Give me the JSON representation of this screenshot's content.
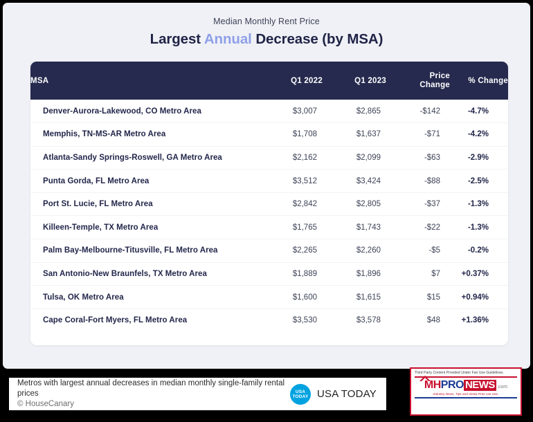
{
  "graphic": {
    "kicker": "Median Monthly Rent Price",
    "headline_pre": "Largest ",
    "headline_highlight": "Annual",
    "headline_post": " Decrease (by MSA)",
    "highlight_color": "#8fa0e8",
    "header_bg": "#262a4e",
    "background": "#f0f1f6"
  },
  "table": {
    "columns": [
      {
        "key": "msa",
        "label": "MSA"
      },
      {
        "key": "q1_2022",
        "label": "Q1 2022"
      },
      {
        "key": "q1_2023",
        "label": "Q1 2023"
      },
      {
        "key": "price_change",
        "label": "Price\nChange",
        "label_line1": "Price",
        "label_line2": "Change"
      },
      {
        "key": "pct_change",
        "label": "% Change"
      }
    ],
    "rows": [
      {
        "msa": "Denver-Aurora-Lakewood, CO Metro Area",
        "q1_2022": "$3,007",
        "q1_2023": "$2,865",
        "price_change": "-$142",
        "pct_change": "-4.7%"
      },
      {
        "msa": "Memphis, TN-MS-AR Metro Area",
        "q1_2022": "$1,708",
        "q1_2023": "$1,637",
        "price_change": "-$71",
        "pct_change": "-4.2%"
      },
      {
        "msa": "Atlanta-Sandy Springs-Roswell, GA Metro Area",
        "q1_2022": "$2,162",
        "q1_2023": "$2,099",
        "price_change": "-$63",
        "pct_change": "-2.9%"
      },
      {
        "msa": "Punta Gorda, FL Metro Area",
        "q1_2022": "$3,512",
        "q1_2023": "$3,424",
        "price_change": "-$88",
        "pct_change": "-2.5%"
      },
      {
        "msa": "Port St. Lucie, FL Metro Area",
        "q1_2022": "$2,842",
        "q1_2023": "$2,805",
        "price_change": "-$37",
        "pct_change": "-1.3%"
      },
      {
        "msa": "Killeen-Temple, TX Metro Area",
        "q1_2022": "$1,765",
        "q1_2023": "$1,743",
        "price_change": "-$22",
        "pct_change": "-1.3%"
      },
      {
        "msa": "Palm Bay-Melbourne-Titusville, FL Metro Area",
        "q1_2022": "$2,265",
        "q1_2023": "$2,260",
        "price_change": "-$5",
        "pct_change": "-0.2%"
      },
      {
        "msa": "San Antonio-New Braunfels, TX Metro Area",
        "q1_2022": "$1,889",
        "q1_2023": "$1,896",
        "price_change": "$7",
        "pct_change": "+0.37%"
      },
      {
        "msa": "Tulsa, OK Metro Area",
        "q1_2022": "$1,600",
        "q1_2023": "$1,615",
        "price_change": "$15",
        "pct_change": "+0.94%"
      },
      {
        "msa": "Cape Coral-Fort Myers, FL Metro Area",
        "q1_2022": "$3,530",
        "q1_2023": "$3,578",
        "price_change": "$48",
        "pct_change": "+1.36%"
      }
    ]
  },
  "caption": {
    "line1": "Metros with largest annual decreases in median monthly single-family rental prices",
    "line2": "© HouseCanary"
  },
  "usatoday": {
    "circle_line1": "USA",
    "circle_line2": "TODAY",
    "wordmark": "USA TODAY",
    "brand_color": "#00a3e0"
  },
  "mhpronews": {
    "fair_use": "Third Party Content Provided Under Fair Use Guidelines.",
    "mh": "MH",
    "pro": "PRO",
    "news": "NEWS",
    "dotcom": ".com",
    "tagline": "Industry News, Tips and Views Pros can Use.",
    "red": "#c8102e",
    "blue": "#1b3a93"
  },
  "chart_data": {
    "type": "table",
    "title": "Largest Annual Decrease (by MSA)",
    "subtitle": "Median Monthly Rent Price",
    "source": "© HouseCanary",
    "columns": [
      "MSA",
      "Q1 2022",
      "Q1 2023",
      "Price Change",
      "% Change"
    ],
    "rows": [
      [
        "Denver-Aurora-Lakewood, CO Metro Area",
        3007,
        2865,
        -142,
        -4.7
      ],
      [
        "Memphis, TN-MS-AR Metro Area",
        1708,
        1637,
        -71,
        -4.2
      ],
      [
        "Atlanta-Sandy Springs-Roswell, GA Metro Area",
        2162,
        2099,
        -63,
        -2.9
      ],
      [
        "Punta Gorda, FL Metro Area",
        3512,
        3424,
        -88,
        -2.5
      ],
      [
        "Port St. Lucie, FL Metro Area",
        2842,
        2805,
        -37,
        -1.3
      ],
      [
        "Killeen-Temple, TX Metro Area",
        1765,
        1743,
        -22,
        -1.3
      ],
      [
        "Palm Bay-Melbourne-Titusville, FL Metro Area",
        2265,
        2260,
        -5,
        -0.2
      ],
      [
        "San Antonio-New Braunfels, TX Metro Area",
        1889,
        1896,
        7,
        0.37
      ],
      [
        "Tulsa, OK Metro Area",
        1600,
        1615,
        15,
        0.94
      ],
      [
        "Cape Coral-Fort Myers, FL Metro Area",
        3530,
        3578,
        48,
        1.36
      ]
    ],
    "units": {
      "Q1 2022": "USD/month",
      "Q1 2023": "USD/month",
      "Price Change": "USD",
      "% Change": "percent"
    }
  }
}
